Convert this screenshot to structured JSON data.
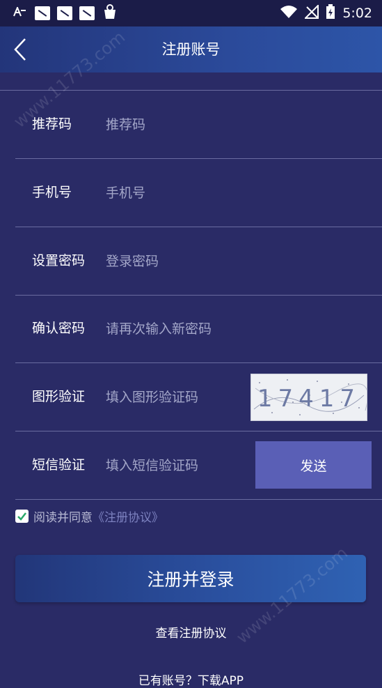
{
  "status_bar": {
    "time": "5:02",
    "icons": [
      "a-icon",
      "image-icon",
      "image-icon",
      "image-icon",
      "bag-icon",
      "wifi-icon",
      "signal-off-icon",
      "battery-charging-icon"
    ]
  },
  "header": {
    "title": "注册账号",
    "back_icon": "chevron-left-icon"
  },
  "form": {
    "referral": {
      "label": "推荐码",
      "placeholder": "推荐码"
    },
    "phone": {
      "label": "手机号",
      "placeholder": "手机号"
    },
    "password": {
      "label": "设置密码",
      "placeholder": "登录密码"
    },
    "confirm": {
      "label": "确认密码",
      "placeholder": "请再次输入新密码"
    },
    "captcha": {
      "label": "图形验证",
      "placeholder": "填入图形验证码",
      "image_text": "17417"
    },
    "sms": {
      "label": "短信验证",
      "placeholder": "填入短信验证码",
      "send_label": "发送"
    }
  },
  "agreement": {
    "checked": true,
    "text": "阅读并同意",
    "link": "《注册协议》"
  },
  "register_button": "注册并登录",
  "view_agreement": "查看注册协议",
  "bottom_link": "已有账号？下载APP",
  "watermark": "www.11773.com",
  "colors": {
    "background": "#2a2b66",
    "send_button": "#5a5fb6",
    "divider": "#6a6ca0"
  }
}
